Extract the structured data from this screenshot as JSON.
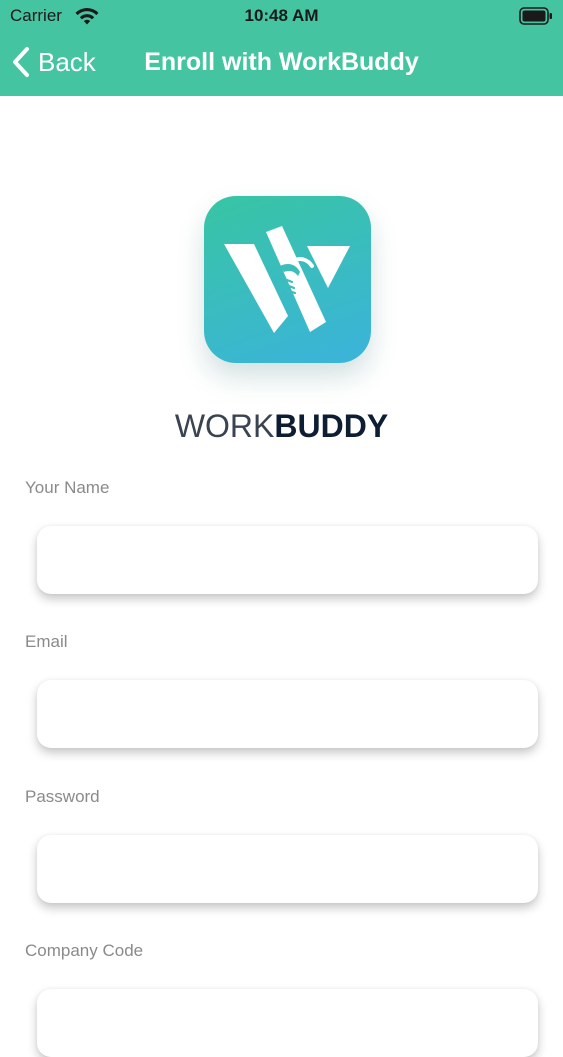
{
  "status_bar": {
    "carrier": "Carrier",
    "time": "10:48 AM",
    "wifi_icon": "wifi-icon",
    "battery_icon": "battery-icon"
  },
  "nav": {
    "back_label": "Back",
    "back_icon": "chevron-left-icon",
    "title": "Enroll with WorkBuddy"
  },
  "colors": {
    "header_bg": "#45c4a1",
    "logo_gradient_start": "#38c5a3",
    "logo_gradient_end": "#3bb3dc",
    "label_text": "#8a8a8a",
    "brand_dark": "#0d1e33"
  },
  "brand": {
    "logo_icon": "workbuddy-logo-icon",
    "name_light": "WORK",
    "name_bold": "BUDDY"
  },
  "form": {
    "fields": [
      {
        "label": "Your Name",
        "value": "",
        "placeholder": ""
      },
      {
        "label": "Email",
        "value": "",
        "placeholder": ""
      },
      {
        "label": "Password",
        "value": "",
        "placeholder": ""
      },
      {
        "label": "Company Code",
        "value": "",
        "placeholder": ""
      }
    ]
  }
}
